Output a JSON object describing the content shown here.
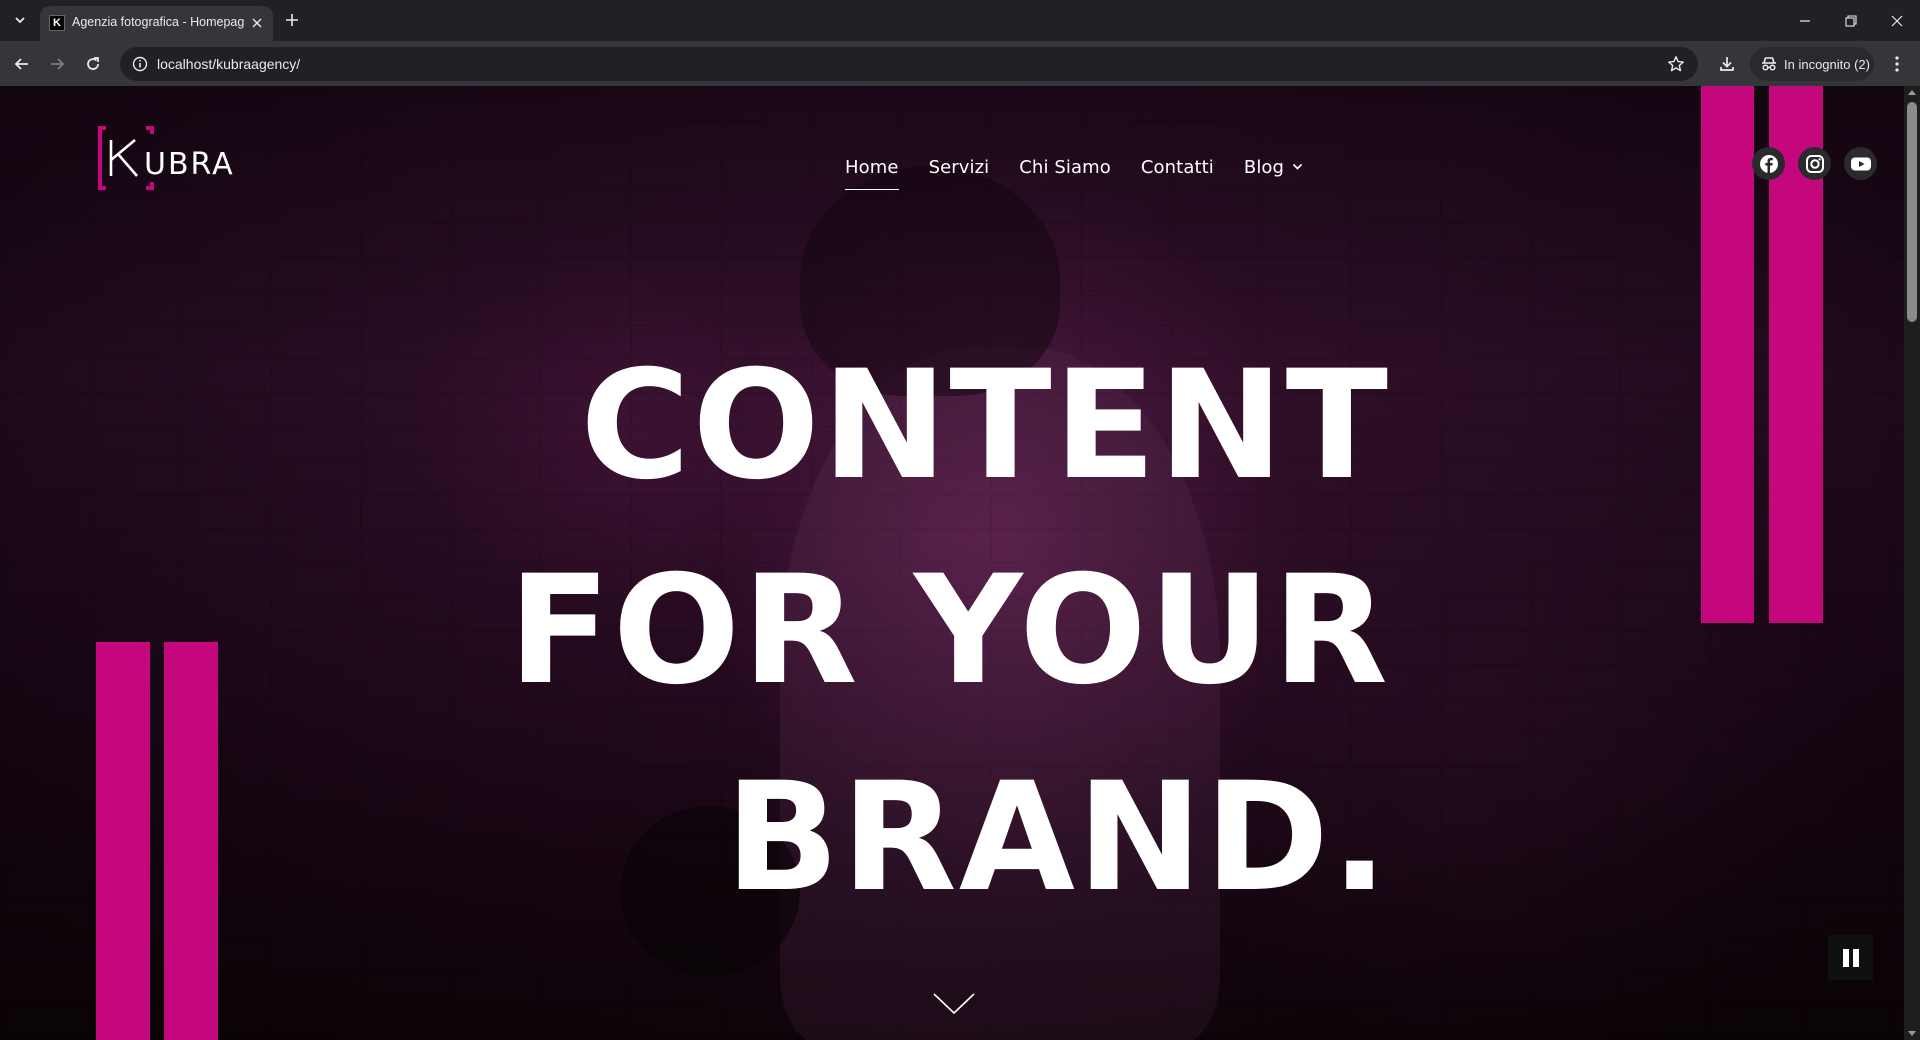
{
  "browser": {
    "tab": {
      "favicon_letter": "K",
      "title": "Agenzia fotografica - Homepage"
    },
    "address_bar": {
      "url": "localhost/kubraagency/"
    },
    "incognito_label": "In incognito (2)",
    "icons": {
      "tab_search": "chevron-down-icon",
      "tab_close": "close-icon",
      "new_tab": "plus-icon",
      "minimize": "minimize-icon",
      "restore": "restore-icon",
      "close_window": "close-icon",
      "back": "arrow-left-icon",
      "forward": "arrow-right-icon",
      "reload": "reload-icon",
      "site_info": "info-icon",
      "bookmark": "star-icon",
      "download": "download-icon",
      "incognito": "incognito-icon",
      "menu": "kebab-menu-icon"
    }
  },
  "site": {
    "logo_text": "KUBRA",
    "nav": [
      {
        "label": "Home",
        "active": true
      },
      {
        "label": "Servizi"
      },
      {
        "label": "Chi Siamo"
      },
      {
        "label": "Contatti"
      },
      {
        "label": "Blog",
        "has_dropdown": true
      }
    ],
    "socials": [
      {
        "name": "facebook-icon"
      },
      {
        "name": "instagram-icon"
      },
      {
        "name": "youtube-icon"
      }
    ],
    "hero": {
      "lines": [
        "CONTENT",
        "FOR YOUR",
        "BRAND."
      ]
    },
    "scroll_icon": "chevron-down-icon",
    "video_control_icon": "pause-icon"
  },
  "colors": {
    "accent": "#c4077c",
    "chrome_dark": "#202124",
    "chrome_toolbar": "#35363a",
    "text": "#ffffff"
  }
}
